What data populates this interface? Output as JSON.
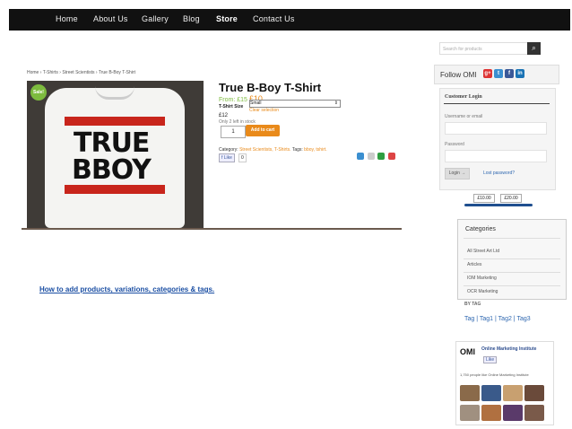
{
  "nav": {
    "items": [
      "Home",
      "About Us",
      "Gallery",
      "Blog",
      "Store",
      "Contact Us"
    ]
  },
  "product": {
    "breadcrumb": "Home › T-Shirts › Street Scientists › True B-Boy T-Shirt",
    "sale_badge": "Sale!",
    "shirt_text_line1": "TRUE",
    "shirt_text_line2": "BBOY",
    "title": "True B-Boy T-Shirt",
    "price_prefix": "From: £15",
    "price_value": "£10",
    "size_label": "T-Shirt Size",
    "size_selected": "Small",
    "clear_selection": "Clear selection",
    "price_detail": "£12",
    "stock": "Only 2 left in stock",
    "quantity": "1",
    "add_to_cart": "Add to cart",
    "category_prefix": "Category:",
    "category_values": "Street Scientists, T-Shirts.",
    "tags_prefix": "Tags:",
    "tags_values": "bboy, tshirt.",
    "like_label": "Like",
    "like_count": "0"
  },
  "howto_link": "How to add products, variations, categories & tags.",
  "sidebar": {
    "search_placeholder": "Search for products",
    "search_icon": "magnifier-icon",
    "follow_label": "Follow OMI",
    "login": {
      "title": "Customer Login",
      "username_label": "Username or email",
      "password_label": "Password",
      "login_button": "Login →",
      "lost_password": "Lost password?"
    },
    "price_range": {
      "min": "£10.00",
      "max": "£20.00"
    },
    "categories": {
      "title": "Categories",
      "items": [
        "All Street Art Ltd",
        "Articles",
        "IOM Marketing",
        "OCR Marketing"
      ]
    },
    "by_tag": {
      "title": "BY TAG",
      "tags": [
        "Tag",
        "Tag1",
        "Tag2",
        "Tag3"
      ]
    },
    "omi_widget": {
      "logo": "OMI",
      "name": "Online Marketing Institute",
      "like": "Like",
      "people": "1,750 people like Online Marketing Institute"
    }
  },
  "colors": {
    "accent_orange": "#e98a1a",
    "sale_green": "#7dbb3e",
    "nav_bg": "#111111",
    "link_blue": "#1a4ea3"
  }
}
